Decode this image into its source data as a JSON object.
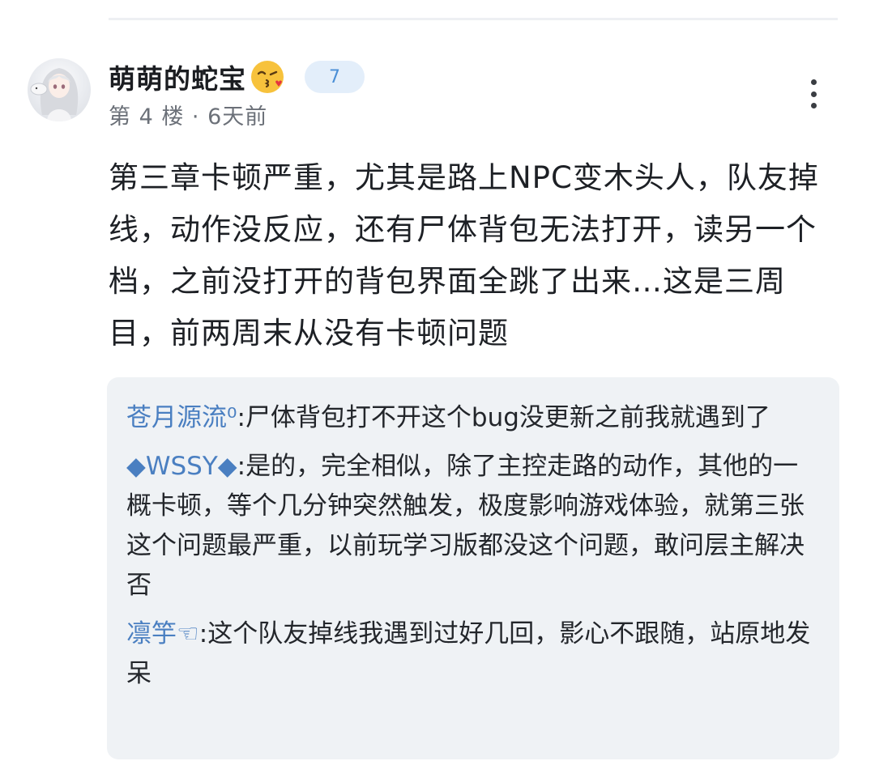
{
  "post": {
    "username": "萌萌的蛇宝",
    "emoji": "kissing-face-emoji",
    "level": "7",
    "meta": "第 4 楼 · 6天前",
    "content": "第三章卡顿严重，尤其是路上NPC变木头人，队友掉线，动作没反应，还有尸体背包无法打开，读另一个档，之前没打开的背包界面全跳了出来…这是三周目，前两周末从没有卡顿问题"
  },
  "replies": [
    {
      "author": "苍月源流⁰",
      "separator": ":",
      "text": "尸体背包打不开这个bug没更新之前我就遇到了"
    },
    {
      "author": "◆WSSY◆",
      "separator": ":",
      "text": "是的，完全相似，除了主控走路的动作，其他的一概卡顿，等个几分钟突然触发，极度影响游戏体验，就第三张这个问题最严重，以前玩学习版都没这个问题，敢问层主解决否"
    },
    {
      "author": "凛竽☜",
      "separator": ":",
      "text": "这个队友掉线我遇到过好几回，影心不跟随，站原地发呆"
    }
  ],
  "colors": {
    "accent": "#4a7fc1",
    "badge_bg": "#e3eefa",
    "badge_text": "#4b8fd6",
    "reply_bg": "#eff2f5",
    "meta_text": "#6b7078"
  }
}
